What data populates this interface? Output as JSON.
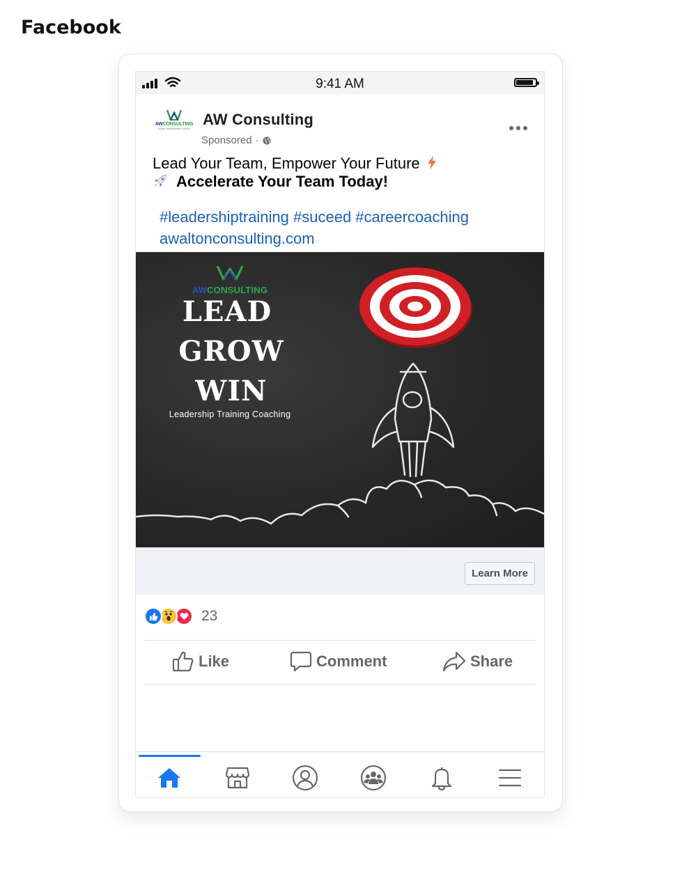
{
  "page_label": "Facebook",
  "status_bar": {
    "time": "9:41 AM",
    "battery_level": 0.9
  },
  "post": {
    "page_name": "AW Consulting",
    "sponsored_label": "Sponsored",
    "logo_text_blue": "AW",
    "logo_text_green": "CONSULTING",
    "logo_subtext": "TALENT DEVELOPMENT GROUP",
    "caption_line1": "Lead Your Team, Empower Your Future",
    "caption_line2": "Accelerate Your Team Today!",
    "hashtags": "#leadershiptraining #suceed #careercoaching",
    "link": "awaltonconsulting.com"
  },
  "ad_image": {
    "logo_blue": "AW",
    "logo_green": "CONSULTING",
    "headline1": "LEAD",
    "headline2": "GROW",
    "headline3": "WIN",
    "subtitle": "Leadership Training Coaching"
  },
  "cta": {
    "label": "Learn More"
  },
  "reactions": {
    "count": "23"
  },
  "actions": {
    "like": "Like",
    "comment": "Comment",
    "share": "Share"
  },
  "bottom_nav": [
    "home-icon",
    "marketplace-icon",
    "profile-icon",
    "groups-icon",
    "notifications-icon",
    "menu-icon"
  ],
  "colors": {
    "link": "#1a61b8",
    "accent": "#1877f2",
    "cta_bar": "#f0f2f5",
    "ad_background": "#2a2a2a",
    "target_red": "#d11f26"
  }
}
